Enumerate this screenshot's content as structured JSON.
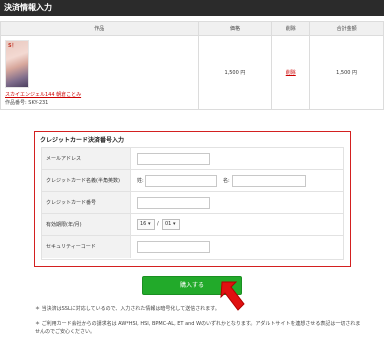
{
  "header": {
    "title": "決済情報入力"
  },
  "order_table": {
    "columns": [
      "作品",
      "価格",
      "削除",
      "合計金額"
    ],
    "item": {
      "cover_text": "S！",
      "title": "スカイエンジェル144 朝倉ことみ",
      "product_number": "作品番号: SKY-231",
      "price": "1,500 円",
      "delete_label": "削除",
      "total": "1,500 円"
    }
  },
  "credit_form": {
    "title": "クレジットカード決済番号入力",
    "fields": {
      "email_label": "メールアドレス",
      "name_label": "クレジットカード名義(半角英数)",
      "last_name_prefix": "姓:",
      "first_name_prefix": "名:",
      "card_number_label": "クレジットカード番号",
      "expiry_label": "有効期限(年/月)",
      "expiry_year": "16 ▾",
      "expiry_separator": "/",
      "expiry_month": "01 ▾",
      "security_code_label": "セキュリティーコード"
    }
  },
  "purchase_button": {
    "label": "購入する"
  },
  "notes": {
    "ssl": "＊ 当決済はSSLに対応しているので、入力された情報は暗号化して送信されます。",
    "cards": "＊ ご利用カード会社からの請求名は AW*HSI, HSI, BPMC-AL, ET and Wのいずれかとなります。アダルトサイトを連想させる表記は一切されませんのでご安心ください。"
  },
  "colors": {
    "header_bg": "#2b2b2b",
    "accent_red": "#d32020",
    "button_green": "#22aa2a"
  }
}
